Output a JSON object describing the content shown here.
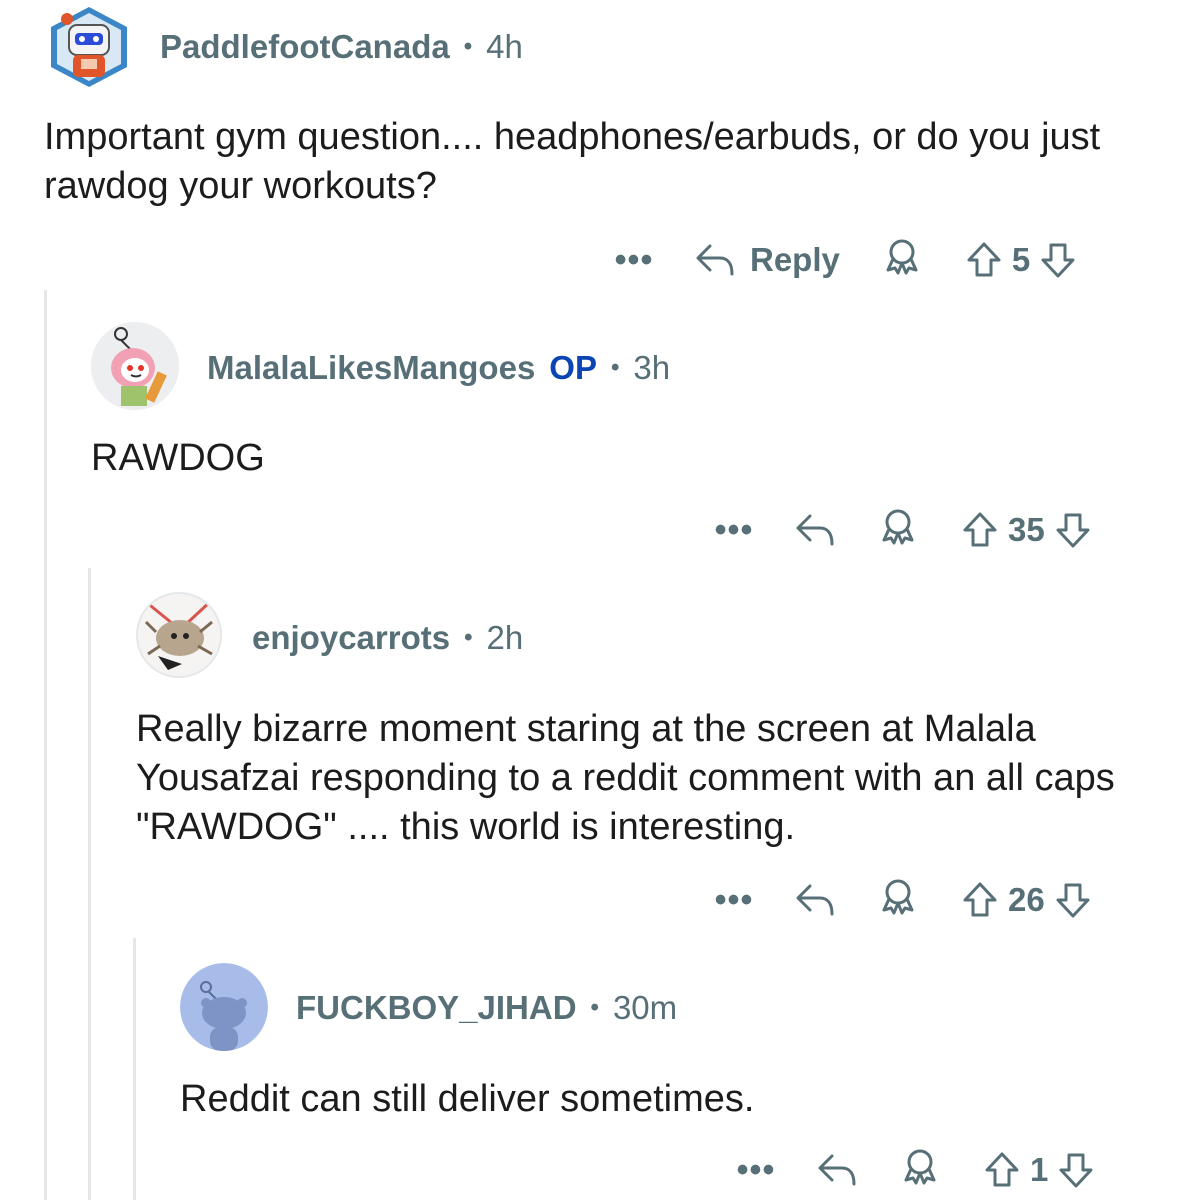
{
  "comments": [
    {
      "username": "PaddlefootCanada",
      "time": "4h",
      "text": "Important gym question.... headphones/earbuds, or do you just rawdog your workouts?",
      "reply_label": "Reply",
      "score": "5",
      "avatar_icon": "robot-avatar-icon"
    },
    {
      "username": "MalalaLikesMangoes",
      "op_badge": "OP",
      "time": "3h",
      "text": "RAWDOG",
      "score": "35",
      "avatar_icon": "snoo-hijab-avatar-icon"
    },
    {
      "username": "enjoycarrots",
      "time": "2h",
      "text": "Really bizarre moment staring at the screen at Malala Yousafzai responding to a reddit comment with an all caps \"RAWDOG\" .... this world is interesting.",
      "score": "26",
      "avatar_icon": "anime-creature-avatar-icon"
    },
    {
      "username": "FUCKBOY_JIHAD",
      "time": "30m",
      "text": "Reddit can still deliver sometimes.",
      "score": "1",
      "avatar_icon": "default-snoo-avatar-icon"
    }
  ],
  "ui": {
    "separator": "•",
    "more_label": "•••"
  },
  "colors": {
    "meta": "#576f76",
    "op": "#0a45b3",
    "thread_line": "#e4e6e8",
    "text": "#1c1c1c"
  }
}
